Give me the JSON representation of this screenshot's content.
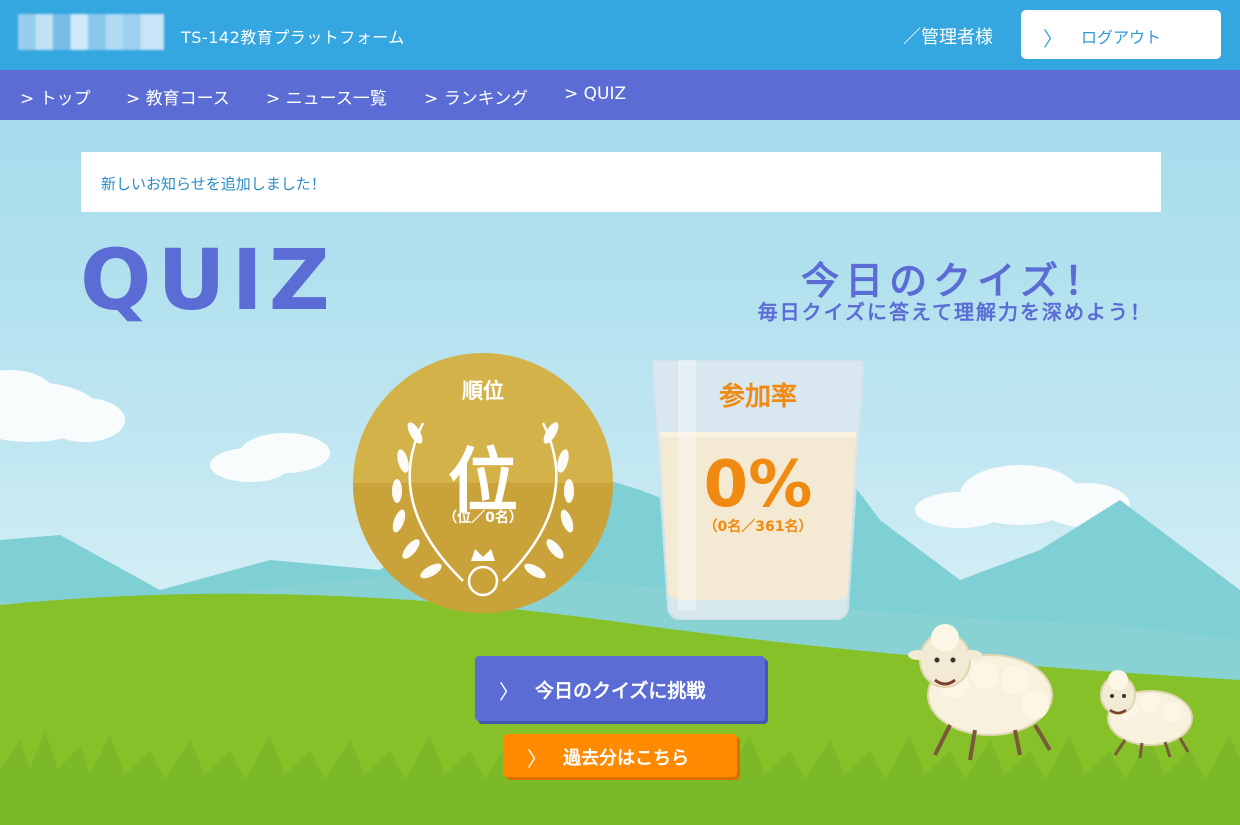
{
  "header": {
    "platform_name": "TS-142教育プラットフォーム",
    "user_label": "／管理者様",
    "logout_label": "ログアウト"
  },
  "nav": {
    "items": [
      {
        "label": "> トップ"
      },
      {
        "label": "> 教育コース"
      },
      {
        "label": "> ニュース一覧"
      },
      {
        "label": "> ランキング"
      },
      {
        "label": "> QUIZ"
      }
    ]
  },
  "notice": {
    "text": "新しいお知らせを追加しました！"
  },
  "quiz": {
    "title": "QUIZ",
    "headline": "今日のクイズ！",
    "subline": "毎日クイズに答えて理解力を深めよう！"
  },
  "rank": {
    "label": "順位",
    "value": "位",
    "detail": "（位／0名）"
  },
  "participation": {
    "label": "参加率",
    "value": "0%",
    "detail": "（0名／361名）"
  },
  "buttons": {
    "challenge": "今日のクイズに挑戦",
    "past": "過去分はこちら"
  },
  "colors": {
    "header": "#34a6e0",
    "nav": "#5b6dd4",
    "accent_orange": "#ff8a00",
    "medal_gold": "#d4b24a",
    "grass": "#86c12a"
  },
  "icons": {
    "chevron": "chevron-right-icon",
    "laurel": "laurel-wreath-icon",
    "crown": "crown-icon",
    "sheep": "sheep-icon"
  }
}
